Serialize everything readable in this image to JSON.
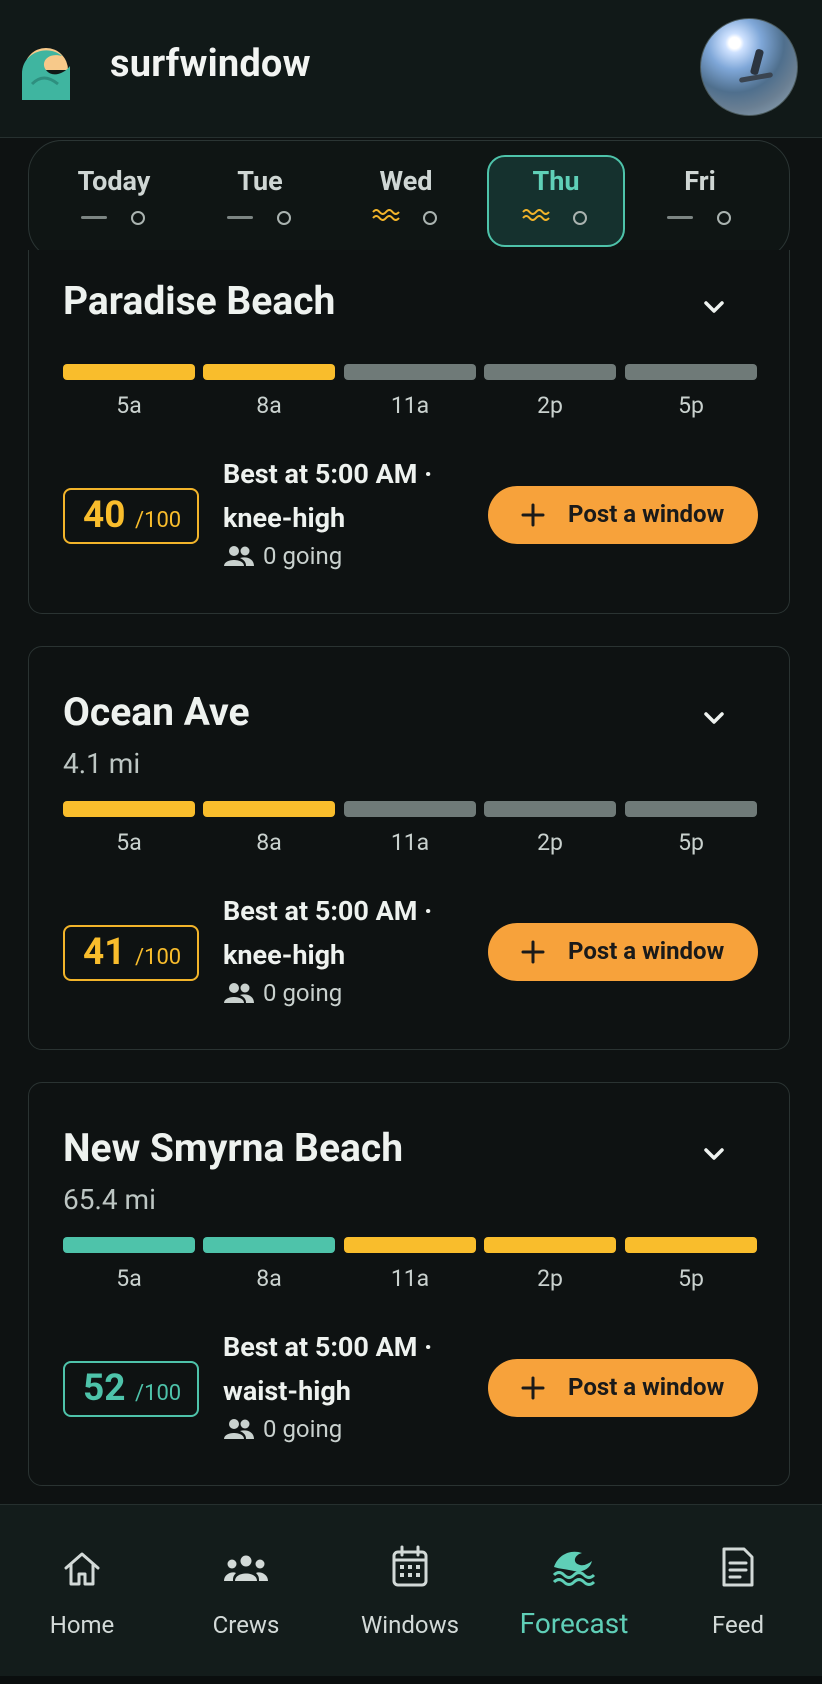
{
  "app": {
    "name": "surfwindow"
  },
  "colors": {
    "accent_teal": "#4ec3aa",
    "amber": "#f9bd2c",
    "gray_bar": "#6f7a78",
    "post_orange": "#f7a23b",
    "background": "#0e1212"
  },
  "days": [
    {
      "label": "Today",
      "indicator": "dash",
      "selected": false
    },
    {
      "label": "Tue",
      "indicator": "dash",
      "selected": false
    },
    {
      "label": "Wed",
      "indicator": "wave",
      "selected": false
    },
    {
      "label": "Thu",
      "indicator": "wave",
      "selected": true
    },
    {
      "label": "Fri",
      "indicator": "dash",
      "selected": false
    }
  ],
  "spots": [
    {
      "name": "Paradise Beach",
      "distance": "",
      "times": [
        "5a",
        "8a",
        "11a",
        "2p",
        "5p"
      ],
      "bar_ratings": [
        "fair",
        "fair",
        "poor",
        "poor",
        "poor"
      ],
      "score": "40",
      "score_suffix": "/100",
      "score_color": "#f9bd2c",
      "best_line1": "Best at 5:00 AM ·",
      "best_line2": "knee-high",
      "going": "0 going",
      "post_label": "Post a window"
    },
    {
      "name": "Ocean Ave",
      "distance": "4.1 mi",
      "times": [
        "5a",
        "8a",
        "11a",
        "2p",
        "5p"
      ],
      "bar_ratings": [
        "fair",
        "fair",
        "poor",
        "poor",
        "poor"
      ],
      "score": "41",
      "score_suffix": "/100",
      "score_color": "#f9bd2c",
      "best_line1": "Best at 5:00 AM ·",
      "best_line2": "knee-high",
      "going": "0 going",
      "post_label": "Post a window"
    },
    {
      "name": "New Smyrna Beach",
      "distance": "65.4 mi",
      "times": [
        "5a",
        "8a",
        "11a",
        "2p",
        "5p"
      ],
      "bar_ratings": [
        "good",
        "good",
        "fair",
        "fair",
        "fair"
      ],
      "score": "52",
      "score_suffix": "/100",
      "score_color": "#4ec3aa",
      "best_line1": "Best at 5:00 AM ·",
      "best_line2": "waist-high",
      "going": "0 going",
      "post_label": "Post a window"
    }
  ],
  "nav": [
    {
      "label": "Home",
      "icon": "home-icon",
      "active": false
    },
    {
      "label": "Crews",
      "icon": "crews-icon",
      "active": false
    },
    {
      "label": "Windows",
      "icon": "calendar-icon",
      "active": false
    },
    {
      "label": "Forecast",
      "icon": "wave-icon",
      "active": true
    },
    {
      "label": "Feed",
      "icon": "feed-icon",
      "active": false
    }
  ]
}
